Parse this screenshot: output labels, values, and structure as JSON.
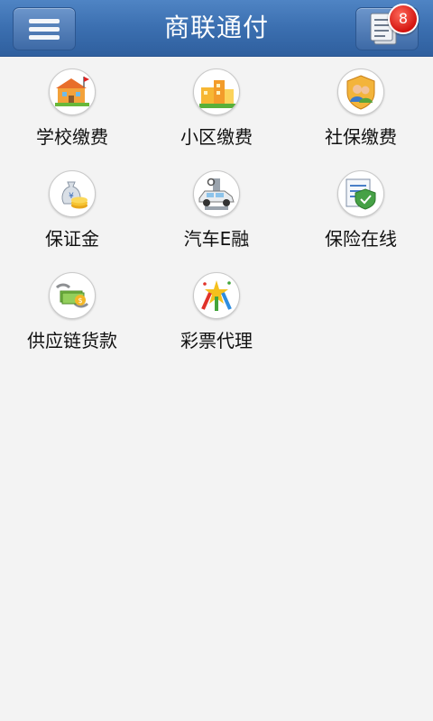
{
  "header": {
    "title": "商联通付",
    "badge_count": "8"
  },
  "services": [
    {
      "label": "学校缴费",
      "icon": "school-icon"
    },
    {
      "label": "小区缴费",
      "icon": "residential-icon"
    },
    {
      "label": "社保缴费",
      "icon": "social-security-icon"
    },
    {
      "label": "保证金",
      "icon": "money-bag-icon"
    },
    {
      "label": "汽车E融",
      "icon": "car-icon"
    },
    {
      "label": "保险在线",
      "icon": "insurance-shield-icon"
    },
    {
      "label": "供应链货款",
      "icon": "supply-chain-icon"
    },
    {
      "label": "彩票代理",
      "icon": "lottery-icon"
    }
  ],
  "colors": {
    "header": "#3b6fb0",
    "badge": "#d3140f",
    "background": "#f3f3f3"
  }
}
